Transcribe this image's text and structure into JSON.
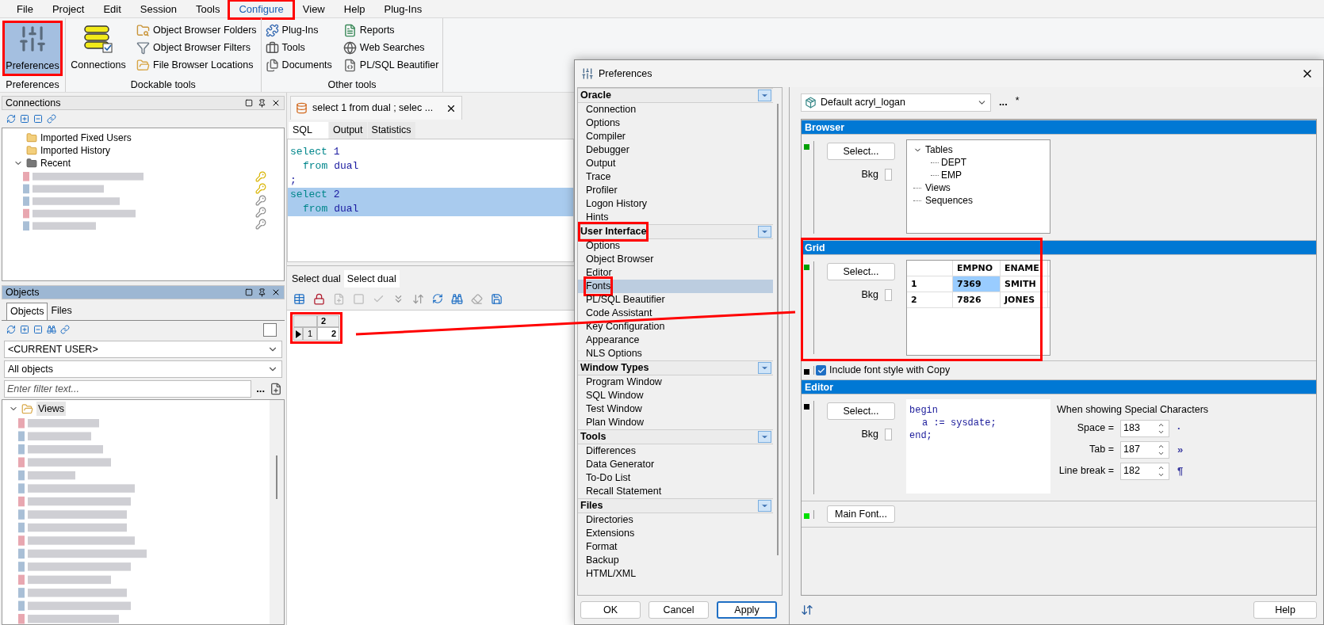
{
  "menu": [
    {
      "label": "File",
      "selected": false,
      "highlighted": false
    },
    {
      "label": "Project",
      "selected": false,
      "highlighted": false
    },
    {
      "label": "Edit",
      "selected": false,
      "highlighted": false
    },
    {
      "label": "Session",
      "selected": false,
      "highlighted": false
    },
    {
      "label": "Tools",
      "selected": false,
      "highlighted": false
    },
    {
      "label": "Configure",
      "selected": true,
      "highlighted": true
    },
    {
      "label": "View",
      "selected": false,
      "highlighted": false
    },
    {
      "label": "Help",
      "selected": false,
      "highlighted": false
    },
    {
      "label": "Plug-Ins",
      "selected": false,
      "highlighted": false
    }
  ],
  "ribbon": [
    {
      "caption": "Preferences",
      "items": [
        {
          "label": "Preferences",
          "kind": "large",
          "selected": true,
          "highlighted": true
        }
      ]
    },
    {
      "caption": "Dockable tools",
      "items": [
        {
          "label": "Connections",
          "kind": "large",
          "selected": false,
          "highlighted": false
        },
        {
          "label": "Object Browser Folders",
          "kind": "small",
          "selected": false,
          "highlighted": false
        },
        {
          "label": "Object Browser Filters",
          "kind": "small",
          "selected": false,
          "highlighted": false
        },
        {
          "label": "File Browser Locations",
          "kind": "small",
          "selected": false,
          "highlighted": false
        }
      ]
    },
    {
      "caption": "Other tools",
      "items": [
        {
          "label": "Plug-Ins",
          "kind": "small",
          "selected": false,
          "highlighted": false
        },
        {
          "label": "Tools",
          "kind": "small",
          "selected": false,
          "highlighted": false
        },
        {
          "label": "Documents",
          "kind": "small",
          "selected": false,
          "highlighted": false
        },
        {
          "label": "Reports",
          "kind": "small",
          "selected": false,
          "highlighted": false
        },
        {
          "label": "Web Searches",
          "kind": "small",
          "selected": false,
          "highlighted": false
        },
        {
          "label": "PL/SQL Beautifier",
          "kind": "small",
          "selected": false,
          "highlighted": false
        }
      ]
    }
  ],
  "connections": {
    "title": "Connections",
    "active": false,
    "tree": [
      {
        "label": "Imported Fixed Users"
      },
      {
        "label": "Imported History"
      },
      {
        "label": "Recent",
        "expanded": true
      }
    ]
  },
  "objects": {
    "title": "Objects",
    "active": true,
    "tabs": [
      {
        "label": "Objects",
        "selected": true
      },
      {
        "label": "Files",
        "selected": false
      }
    ],
    "owner": "<CURRENT USER>",
    "object_type": "All objects",
    "filter": {
      "placeholder": "Enter filter text..."
    },
    "more": "...",
    "tree": [
      {
        "label": "Views",
        "expanded": true
      }
    ]
  },
  "editor": {
    "document_tab": "select 1 from dual ; selec ...",
    "tabs": [
      {
        "label": "SQL",
        "selected": true
      },
      {
        "label": "Output",
        "selected": false
      },
      {
        "label": "Statistics",
        "selected": false
      }
    ],
    "lines": [
      {
        "indented": false,
        "selected": false,
        "tokens": [
          {
            "text": "select",
            "kind": "keyword"
          },
          {
            "text": "1",
            "kind": "name"
          }
        ]
      },
      {
        "indented": true,
        "selected": false,
        "tokens": [
          {
            "text": "from",
            "kind": "keyword"
          },
          {
            "text": "dual",
            "kind": "name"
          }
        ]
      },
      {
        "indented": false,
        "selected": false,
        "tokens": [
          {
            "text": ";",
            "kind": "name"
          }
        ]
      },
      {
        "indented": false,
        "selected": true,
        "tokens": [
          {
            "text": "select",
            "kind": "keyword"
          },
          {
            "text": "2",
            "kind": "name"
          }
        ]
      },
      {
        "indented": true,
        "selected": true,
        "tokens": [
          {
            "text": "from",
            "kind": "keyword"
          },
          {
            "text": "dual",
            "kind": "name"
          }
        ]
      }
    ],
    "result_tabs": [
      {
        "label": "Select dual",
        "selected": false
      },
      {
        "label": "Select dual",
        "selected": true
      }
    ],
    "result_grid": {
      "highlighted": true,
      "column": "2",
      "rows": [
        {
          "number": "1",
          "value": "2",
          "current": true
        }
      ]
    }
  },
  "dialog": {
    "title": "Preferences",
    "categories": [
      {
        "title": "Oracle",
        "highlighted": false,
        "items": [
          {
            "label": "Connection",
            "selected": false,
            "highlighted": false
          },
          {
            "label": "Options",
            "selected": false,
            "highlighted": false
          },
          {
            "label": "Compiler",
            "selected": false,
            "highlighted": false
          },
          {
            "label": "Debugger",
            "selected": false,
            "highlighted": false
          },
          {
            "label": "Output",
            "selected": false,
            "highlighted": false
          },
          {
            "label": "Trace",
            "selected": false,
            "highlighted": false
          },
          {
            "label": "Profiler",
            "selected": false,
            "highlighted": false
          },
          {
            "label": "Logon History",
            "selected": false,
            "highlighted": false
          },
          {
            "label": "Hints",
            "selected": false,
            "highlighted": false
          }
        ]
      },
      {
        "title": "User Interface",
        "highlighted": true,
        "items": [
          {
            "label": "Options",
            "selected": false,
            "highlighted": false
          },
          {
            "label": "Object Browser",
            "selected": false,
            "highlighted": false
          },
          {
            "label": "Editor",
            "selected": false,
            "highlighted": false
          },
          {
            "label": "Fonts",
            "selected": true,
            "highlighted": true
          },
          {
            "label": "PL/SQL Beautifier",
            "selected": false,
            "highlighted": false
          },
          {
            "label": "Code Assistant",
            "selected": false,
            "highlighted": false
          },
          {
            "label": "Key Configuration",
            "selected": false,
            "highlighted": false
          },
          {
            "label": "Appearance",
            "selected": false,
            "highlighted": false
          },
          {
            "label": "NLS Options",
            "selected": false,
            "highlighted": false
          }
        ]
      },
      {
        "title": "Window Types",
        "highlighted": false,
        "items": [
          {
            "label": "Program Window",
            "selected": false,
            "highlighted": false
          },
          {
            "label": "SQL Window",
            "selected": false,
            "highlighted": false
          },
          {
            "label": "Test Window",
            "selected": false,
            "highlighted": false
          },
          {
            "label": "Plan Window",
            "selected": false,
            "highlighted": false
          }
        ]
      },
      {
        "title": "Tools",
        "highlighted": false,
        "items": [
          {
            "label": "Differences",
            "selected": false,
            "highlighted": false
          },
          {
            "label": "Data Generator",
            "selected": false,
            "highlighted": false
          },
          {
            "label": "To-Do List",
            "selected": false,
            "highlighted": false
          },
          {
            "label": "Recall Statement",
            "selected": false,
            "highlighted": false
          }
        ]
      },
      {
        "title": "Files",
        "highlighted": false,
        "items": [
          {
            "label": "Directories",
            "selected": false,
            "highlighted": false
          },
          {
            "label": "Extensions",
            "selected": false,
            "highlighted": false
          },
          {
            "label": "Format",
            "selected": false,
            "highlighted": false
          },
          {
            "label": "Backup",
            "selected": false,
            "highlighted": false
          },
          {
            "label": "HTML/XML",
            "selected": false,
            "highlighted": false
          }
        ]
      }
    ],
    "profile": "Default acryl_logan",
    "more": "...",
    "modified": "*",
    "sections": [
      {
        "kind": "browser",
        "title": "Browser",
        "color": "#00a000",
        "select": "Select...",
        "bkg": "Bkg",
        "bkg_checked": false,
        "tree": [
          {
            "label": "Tables",
            "expanded": true,
            "children": [
              {
                "label": "DEPT"
              },
              {
                "label": "EMP"
              }
            ]
          },
          {
            "label": "Views"
          },
          {
            "label": "Sequences"
          }
        ]
      },
      {
        "kind": "grid",
        "title": "Grid",
        "color": "#00a000",
        "select": "Select...",
        "bkg": "Bkg",
        "bkg_checked": false,
        "highlighted": true,
        "columns": [
          "EMPNO",
          "ENAME"
        ],
        "rows": [
          {
            "number": "1",
            "cells": [
              {
                "text": "7369",
                "selected": true
              },
              {
                "text": "SMITH",
                "selected": false
              }
            ]
          },
          {
            "number": "2",
            "cells": [
              {
                "text": "7826",
                "selected": false
              },
              {
                "text": "JONES",
                "selected": false
              }
            ]
          }
        ]
      },
      {
        "kind": "option",
        "color": "#000000",
        "label": "Include font style with Copy",
        "checked": true
      },
      {
        "kind": "editor",
        "title": "Editor",
        "color": "#000000",
        "select": "Select...",
        "bkg": "Bkg",
        "bkg_checked": false,
        "lines": [
          {
            "text": "begin",
            "indented": false
          },
          {
            "text": "a := sysdate;",
            "indented": true
          },
          {
            "text": "end;",
            "indented": false
          }
        ],
        "special_caption": "When showing Special Characters",
        "special": [
          {
            "label": "Space =",
            "value": "183",
            "glyph": "·"
          },
          {
            "label": "Tab =",
            "value": "187",
            "glyph": "»"
          },
          {
            "label": "Line break =",
            "value": "182",
            "glyph": "¶"
          }
        ]
      },
      {
        "kind": "main_font",
        "color": "#00e000",
        "button": "Main Font..."
      }
    ],
    "buttons": [
      {
        "label": "OK",
        "default": false
      },
      {
        "label": "Cancel",
        "default": false
      },
      {
        "label": "Apply",
        "default": true
      }
    ],
    "help": "Help"
  }
}
